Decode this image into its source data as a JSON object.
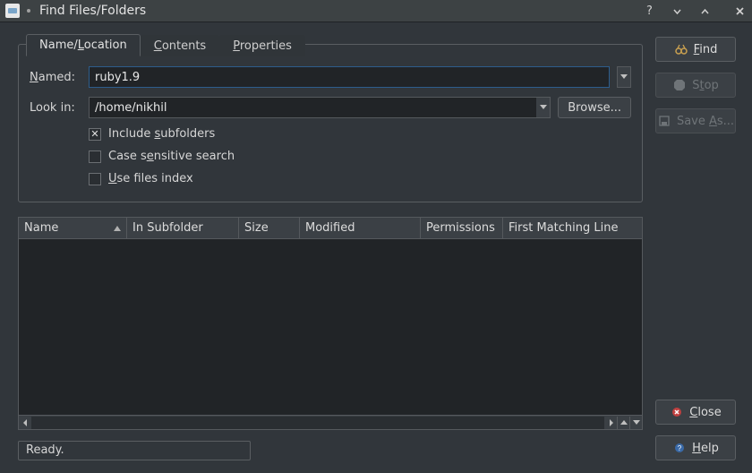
{
  "window": {
    "title": "Find Files/Folders"
  },
  "tabs": {
    "name_location": "Name/Location",
    "contents": "Contents",
    "properties": "Properties"
  },
  "form": {
    "named_label": "Named:",
    "named_value": "ruby1.9",
    "lookin_label": "Look in:",
    "lookin_value": "/home/nikhil",
    "browse_label": "Browse..."
  },
  "checks": {
    "subfolders": "Include subfolders",
    "subfolders_checked": true,
    "case": "Case sensitive search",
    "case_checked": false,
    "index": "Use files index",
    "index_checked": false
  },
  "table": {
    "headers": {
      "name": "Name",
      "subfolder": "In Subfolder",
      "size": "Size",
      "modified": "Modified",
      "permissions": "Permissions",
      "firstmatch": "First Matching Line"
    }
  },
  "status": "Ready.",
  "actions": {
    "find": "Find",
    "stop": "Stop",
    "saveas": "Save As...",
    "close": "Close",
    "help": "Help"
  }
}
